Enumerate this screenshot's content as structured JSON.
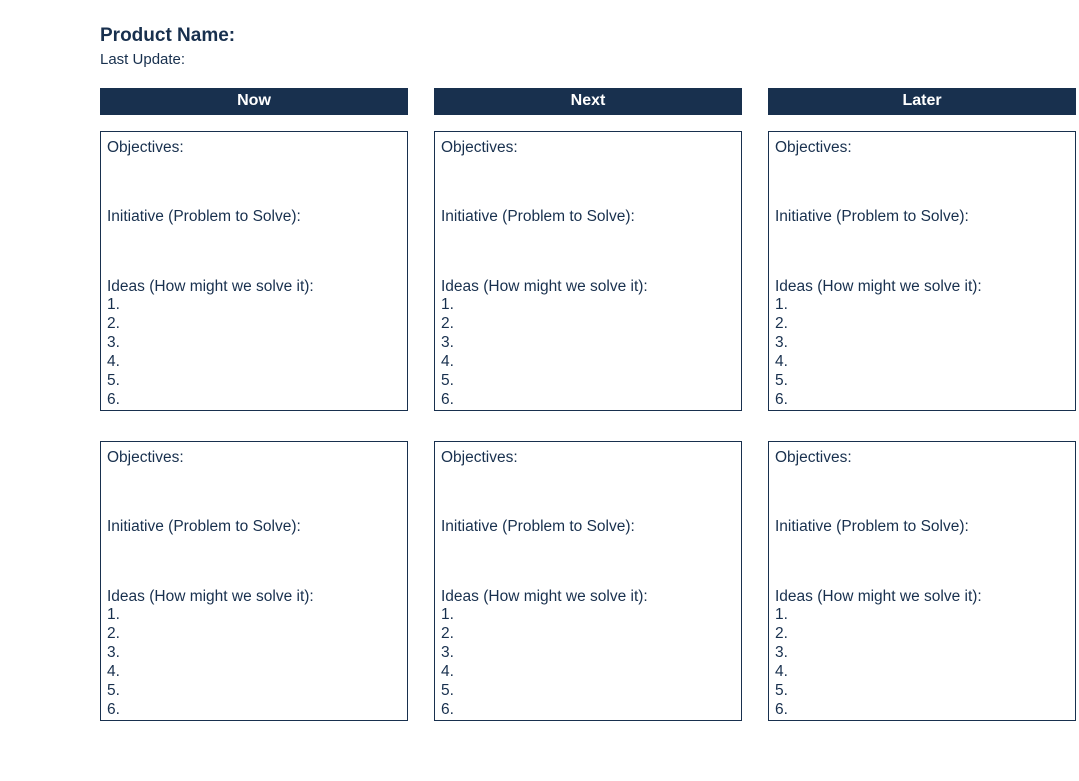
{
  "header": {
    "product_name_label": "Product Name:",
    "last_update_label": "Last Update:"
  },
  "columns": [
    {
      "title": "Now"
    },
    {
      "title": "Next"
    },
    {
      "title": "Later"
    }
  ],
  "card_template": {
    "objectives_label": "Objectives:",
    "initiative_label": "Initiative (Problem to Solve):",
    "ideas_label": "Ideas (How might we solve it):",
    "idea_numbers": [
      "1.",
      "2.",
      "3.",
      "4.",
      "5.",
      "6."
    ]
  },
  "rows_per_column": 2
}
